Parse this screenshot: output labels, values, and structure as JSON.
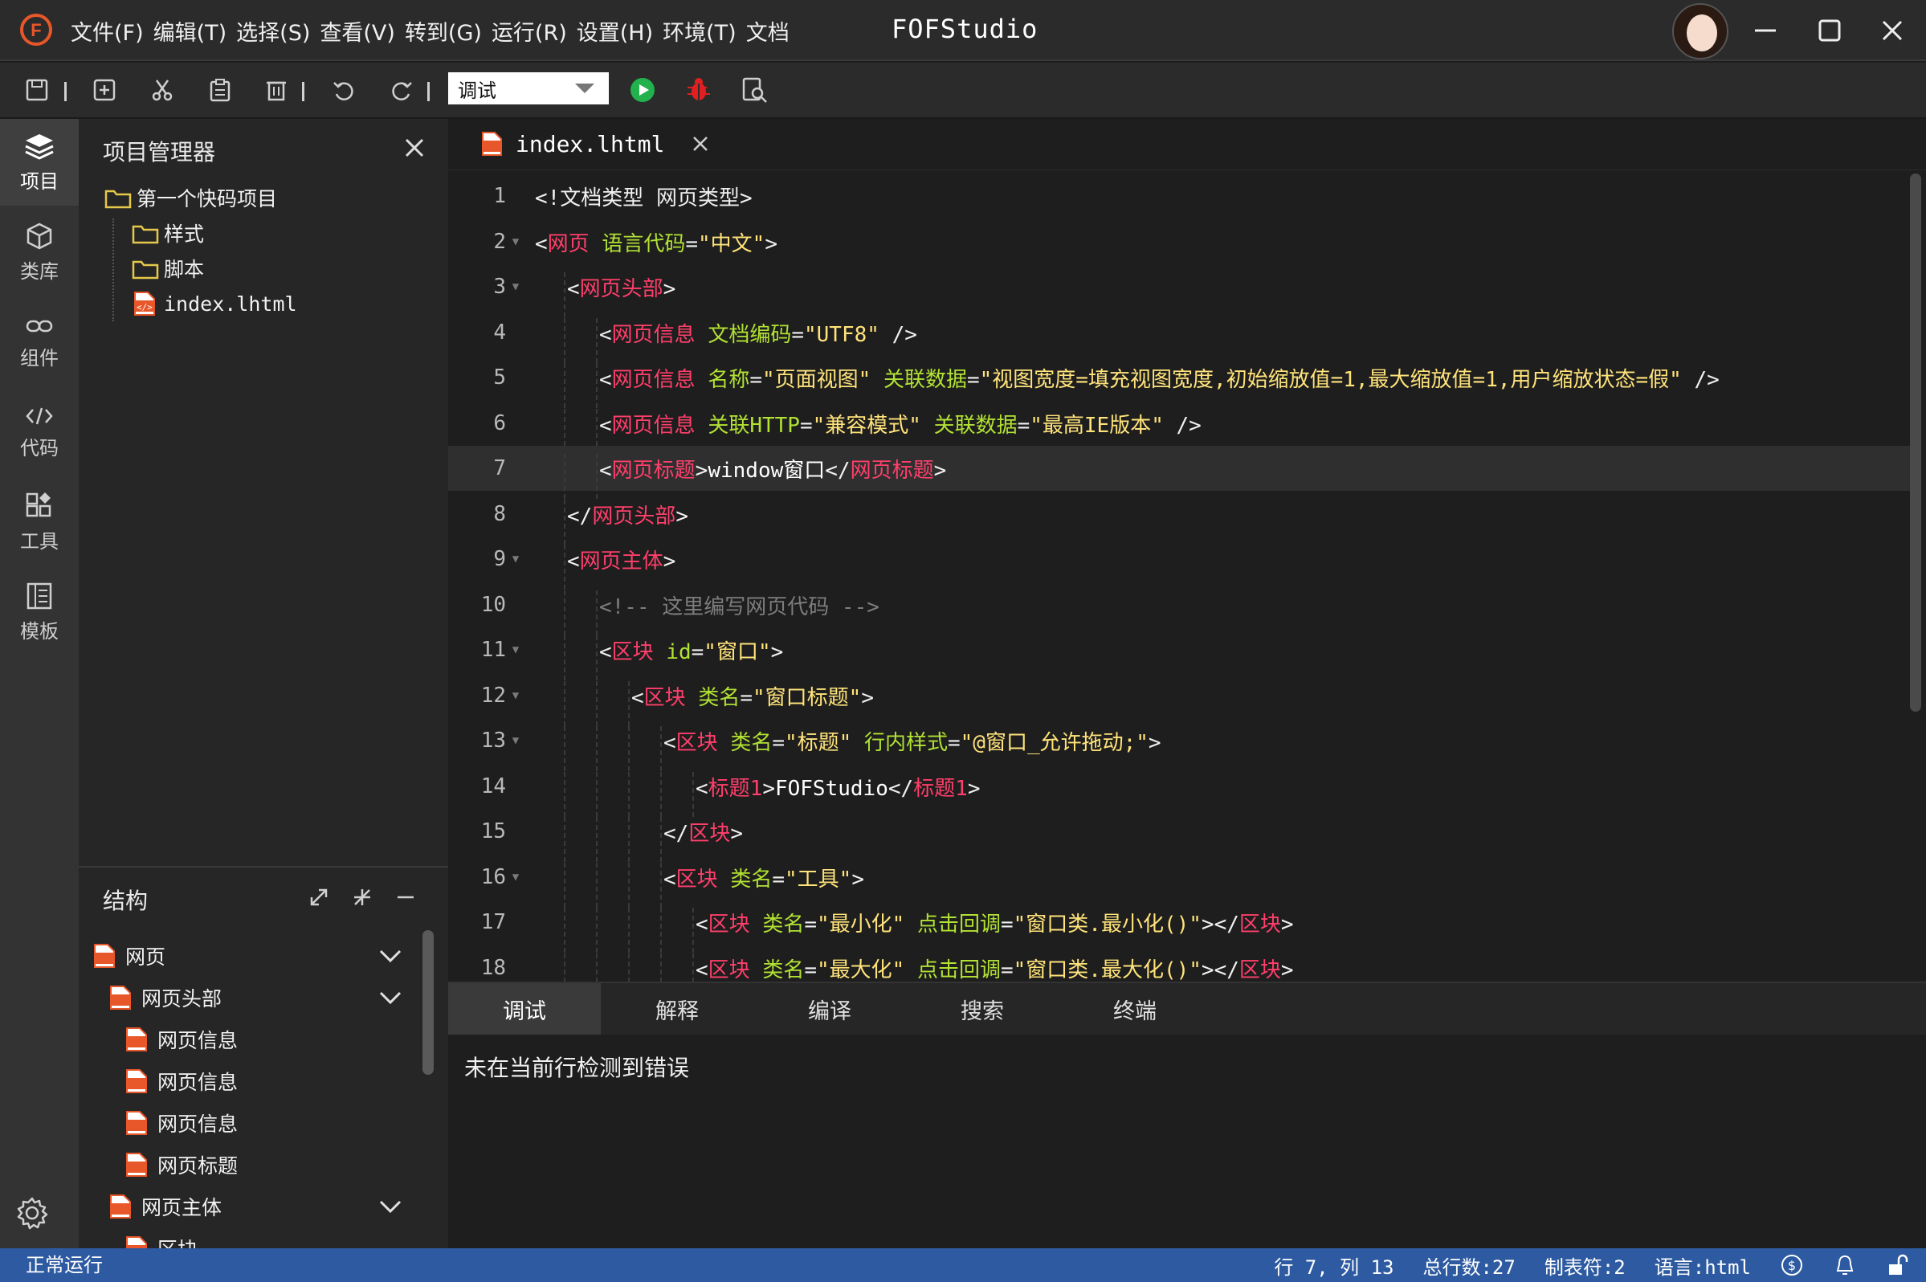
{
  "titlebar": {
    "menu": [
      "文件(F)",
      "编辑(T)",
      "选择(S)",
      "查看(V)",
      "转到(G)",
      "运行(R)",
      "设置(H)",
      "环境(T)",
      "文档"
    ],
    "app_title": "FOFStudio"
  },
  "toolbar": {
    "mode_select": "调试"
  },
  "activity": {
    "items": [
      {
        "label": "项目",
        "icon": "layers-icon"
      },
      {
        "label": "类库",
        "icon": "cube-icon"
      },
      {
        "label": "组件",
        "icon": "link-icon"
      },
      {
        "label": "代码",
        "icon": "code-icon"
      },
      {
        "label": "工具",
        "icon": "widgets-icon"
      },
      {
        "label": "模板",
        "icon": "template-icon"
      }
    ]
  },
  "explorer": {
    "title": "项目管理器",
    "tree": [
      {
        "label": "第一个快码项目",
        "type": "folder"
      },
      {
        "label": "样式",
        "type": "folder"
      },
      {
        "label": "脚本",
        "type": "folder"
      },
      {
        "label": "index.lhtml",
        "type": "file"
      }
    ]
  },
  "structure": {
    "title": "结构",
    "items": [
      "网页",
      "网页头部",
      "网页信息",
      "网页信息",
      "网页信息",
      "网页标题",
      "网页主体",
      "区块"
    ]
  },
  "editor": {
    "tab": "index.lhtml",
    "current_line": 7,
    "lines": [
      [
        [
          "p",
          "<!文档类型 网页类型>"
        ]
      ],
      [
        [
          "p",
          "<"
        ],
        [
          "t",
          "网页"
        ],
        [
          "p",
          " "
        ],
        [
          "a",
          "语言代码"
        ],
        [
          "p",
          "="
        ],
        [
          "s",
          "\"中文\""
        ],
        [
          "p",
          ">"
        ]
      ],
      [
        [
          "p",
          "<"
        ],
        [
          "t",
          "网页头部"
        ],
        [
          "p",
          ">"
        ]
      ],
      [
        [
          "p",
          "<"
        ],
        [
          "t",
          "网页信息"
        ],
        [
          "p",
          " "
        ],
        [
          "a",
          "文档编码"
        ],
        [
          "p",
          "="
        ],
        [
          "s",
          "\"UTF8\""
        ],
        [
          "p",
          " />"
        ]
      ],
      [
        [
          "p",
          "<"
        ],
        [
          "t",
          "网页信息"
        ],
        [
          "p",
          " "
        ],
        [
          "a",
          "名称"
        ],
        [
          "p",
          "="
        ],
        [
          "s",
          "\"页面视图\""
        ],
        [
          "p",
          " "
        ],
        [
          "a",
          "关联数据"
        ],
        [
          "p",
          "="
        ],
        [
          "s",
          "\"视图宽度=填充视图宽度,初始缩放值=1,最大缩放值=1,用户缩放状态=假\""
        ],
        [
          "p",
          " />"
        ]
      ],
      [
        [
          "p",
          "<"
        ],
        [
          "t",
          "网页信息"
        ],
        [
          "p",
          " "
        ],
        [
          "a",
          "关联HTTP"
        ],
        [
          "p",
          "="
        ],
        [
          "s",
          "\"兼容模式\""
        ],
        [
          "p",
          " "
        ],
        [
          "a",
          "关联数据"
        ],
        [
          "p",
          "="
        ],
        [
          "s",
          "\"最高IE版本\""
        ],
        [
          "p",
          " />"
        ]
      ],
      [
        [
          "p",
          "<"
        ],
        [
          "t",
          "网页标题"
        ],
        [
          "p",
          ">"
        ],
        [
          "x",
          "window窗口"
        ],
        [
          "p",
          "</"
        ],
        [
          "t",
          "网页标题"
        ],
        [
          "p",
          ">"
        ]
      ],
      [
        [
          "p",
          "</"
        ],
        [
          "t",
          "网页头部"
        ],
        [
          "p",
          ">"
        ]
      ],
      [
        [
          "p",
          "<"
        ],
        [
          "t",
          "网页主体"
        ],
        [
          "p",
          ">"
        ]
      ],
      [
        [
          "c",
          "<!-- 这里编写网页代码 -->"
        ]
      ],
      [
        [
          "p",
          "<"
        ],
        [
          "t",
          "区块"
        ],
        [
          "p",
          " "
        ],
        [
          "a",
          "id"
        ],
        [
          "p",
          "="
        ],
        [
          "s",
          "\"窗口\""
        ],
        [
          "p",
          ">"
        ]
      ],
      [
        [
          "p",
          "<"
        ],
        [
          "t",
          "区块"
        ],
        [
          "p",
          " "
        ],
        [
          "a",
          "类名"
        ],
        [
          "p",
          "="
        ],
        [
          "s",
          "\"窗口标题\""
        ],
        [
          "p",
          ">"
        ]
      ],
      [
        [
          "p",
          "<"
        ],
        [
          "t",
          "区块"
        ],
        [
          "p",
          " "
        ],
        [
          "a",
          "类名"
        ],
        [
          "p",
          "="
        ],
        [
          "s",
          "\"标题\""
        ],
        [
          "p",
          " "
        ],
        [
          "a",
          "行内样式"
        ],
        [
          "p",
          "="
        ],
        [
          "s",
          "\"@窗口_允许拖动;\""
        ],
        [
          "p",
          ">"
        ]
      ],
      [
        [
          "p",
          "<"
        ],
        [
          "t",
          "标题1"
        ],
        [
          "p",
          ">"
        ],
        [
          "x",
          "FOFStudio"
        ],
        [
          "p",
          "</"
        ],
        [
          "t",
          "标题1"
        ],
        [
          "p",
          ">"
        ]
      ],
      [
        [
          "p",
          "</"
        ],
        [
          "t",
          "区块"
        ],
        [
          "p",
          ">"
        ]
      ],
      [
        [
          "p",
          "<"
        ],
        [
          "t",
          "区块"
        ],
        [
          "p",
          " "
        ],
        [
          "a",
          "类名"
        ],
        [
          "p",
          "="
        ],
        [
          "s",
          "\"工具\""
        ],
        [
          "p",
          ">"
        ]
      ],
      [
        [
          "p",
          "<"
        ],
        [
          "t",
          "区块"
        ],
        [
          "p",
          " "
        ],
        [
          "a",
          "类名"
        ],
        [
          "p",
          "="
        ],
        [
          "s",
          "\"最小化\""
        ],
        [
          "p",
          " "
        ],
        [
          "a",
          "点击回调"
        ],
        [
          "p",
          "="
        ],
        [
          "s",
          "\"窗口类.最小化()\""
        ],
        [
          "p",
          "></"
        ],
        [
          "t",
          "区块"
        ],
        [
          "p",
          ">"
        ]
      ],
      [
        [
          "p",
          "<"
        ],
        [
          "t",
          "区块"
        ],
        [
          "p",
          " "
        ],
        [
          "a",
          "类名"
        ],
        [
          "p",
          "="
        ],
        [
          "s",
          "\"最大化\""
        ],
        [
          "p",
          " "
        ],
        [
          "a",
          "点击回调"
        ],
        [
          "p",
          "="
        ],
        [
          "s",
          "\"窗口类.最大化()\""
        ],
        [
          "p",
          "></"
        ],
        [
          "t",
          "区块"
        ],
        [
          "p",
          ">"
        ]
      ]
    ]
  },
  "panel": {
    "tabs": [
      "调试",
      "解释",
      "编译",
      "搜索",
      "终端"
    ],
    "message": "未在当前行检测到错误"
  },
  "statusbar": {
    "left": "正常运行",
    "position": "行 7, 列 13",
    "total_lines": "总行数:27",
    "tab_size": "制表符:2",
    "language": "语言:html"
  },
  "colors": {
    "statusbar": "#2d5aa0",
    "tag": "#ff3f6b",
    "attr": "#b2e233",
    "string": "#ffe37a",
    "logo": "#e8572a"
  }
}
